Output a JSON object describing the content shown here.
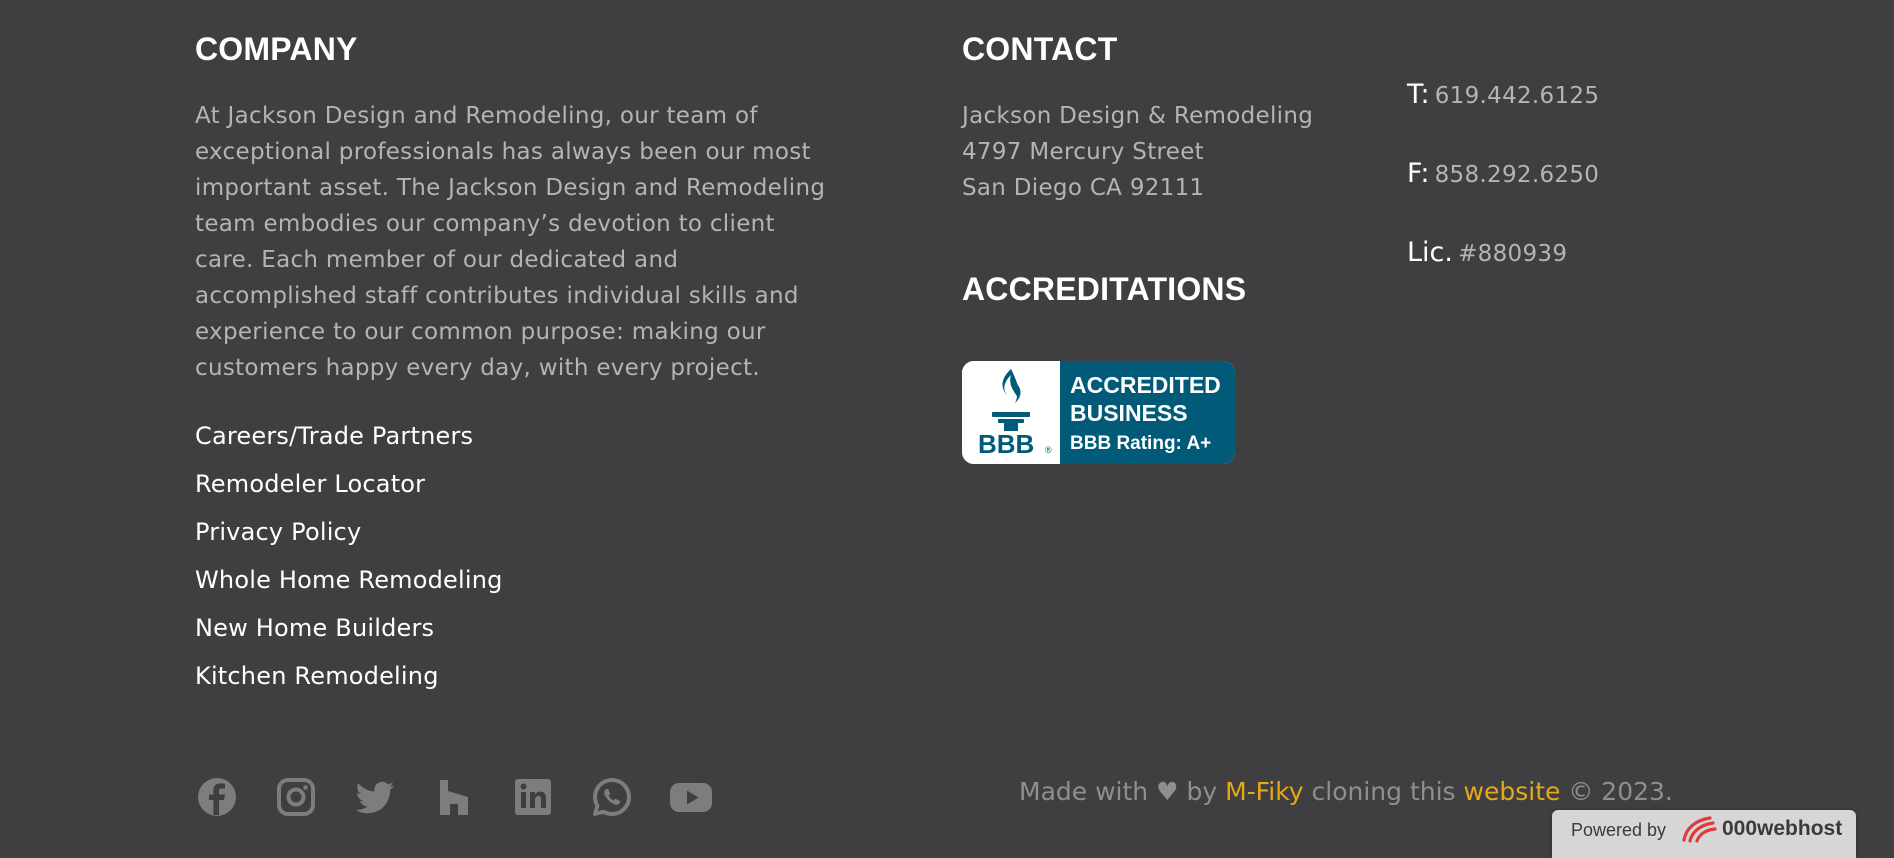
{
  "company": {
    "heading": "COMPANY",
    "about": "At Jackson Design and Remodeling, our team of exceptional professionals has always been our most important asset. The Jackson Design and Remodeling team embodies our company’s devotion to client care. Each member of our dedicated and accomplished staff contributes individual skills and experience to our common purpose: making our customers happy every day, with every project.",
    "links": [
      {
        "label": "Careers/Trade Partners"
      },
      {
        "label": "Remodeler Locator"
      },
      {
        "label": "Privacy Policy"
      },
      {
        "label": "Whole Home Remodeling"
      },
      {
        "label": "New Home Builders"
      },
      {
        "label": "Kitchen Remodeling"
      }
    ]
  },
  "contact": {
    "heading": "CONTACT",
    "address_lines": [
      "Jackson Design & Remodeling",
      "4797 Mercury Street",
      "San Diego CA 92111"
    ],
    "phones": [
      {
        "label": "T:",
        "value": "619.442.6125"
      },
      {
        "label": "F:",
        "value": "858.292.6250"
      },
      {
        "label": "Lic.",
        "value": "#880939"
      }
    ]
  },
  "accreditations": {
    "heading": "ACCREDITATIONS",
    "badge": {
      "line1": "ACCREDITED",
      "line2": "BUSINESS",
      "line3": "BBB Rating: A+",
      "logo_text": "BBB",
      "logo_mark": "®",
      "blue": "#005a78",
      "icon": "bbb-torch-icon"
    }
  },
  "social": {
    "icons": [
      "facebook-icon",
      "instagram-icon",
      "twitter-icon",
      "houzz-icon",
      "linkedin-icon",
      "whatsapp-icon",
      "youtube-icon"
    ],
    "icon_color": "#7d7d7d"
  },
  "credit": {
    "prefix": "Made with",
    "heart": "♥",
    "by": "by",
    "author": "M-Fiky",
    "middle": "cloning this",
    "link": "website",
    "suffix": "© 2023.",
    "link_color": "#e6a817"
  },
  "powered": {
    "label": "Powered by",
    "host": "000webhost",
    "logo_icon": "000webhost-swirl-icon"
  },
  "colors": {
    "background": "#3f3f41",
    "heading": "#ffffff",
    "body_text": "#b4b4b4"
  }
}
